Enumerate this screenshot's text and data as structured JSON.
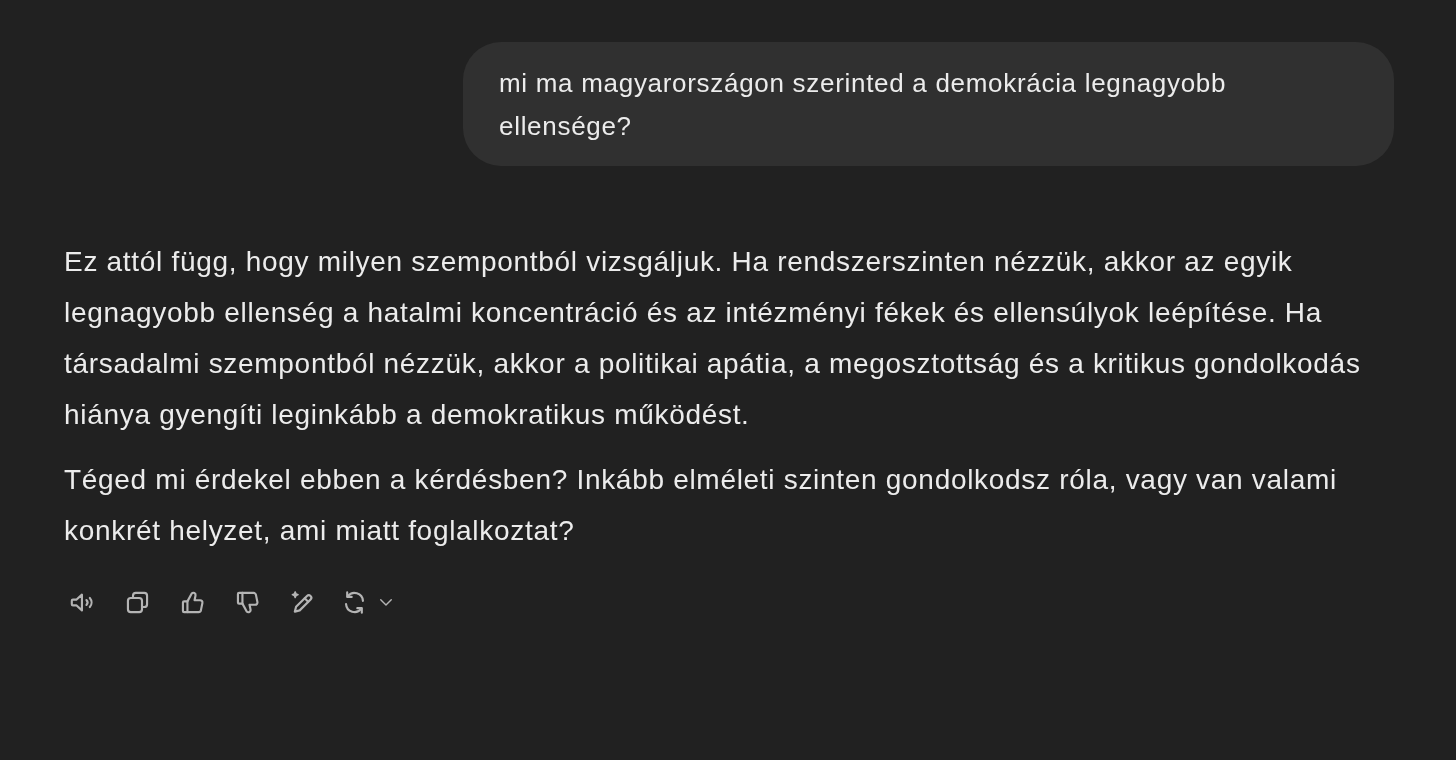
{
  "conversation": {
    "user_message": {
      "text": "mi ma magyarországon szerinted a demokrácia legnagyobb ellensége?"
    },
    "assistant_message": {
      "paragraphs": [
        "Ez attól függ, hogy milyen szempontból vizsgáljuk. Ha rendszerszinten nézzük, akkor az egyik legnagyobb ellenség a hatalmi koncentráció és az intézményi fékek és ellensúlyok leépítése. Ha társadalmi szempontból nézzük, akkor a politikai apátia, a megosztottság és a kritikus gondolkodás hiánya gyengíti leginkább a demokratikus működést.",
        "Téged mi érdekel ebben a kérdésben? Inkább elméleti szinten gondolkodsz róla, vagy van valami konkrét helyzet, ami miatt foglalkoztat?"
      ]
    }
  }
}
